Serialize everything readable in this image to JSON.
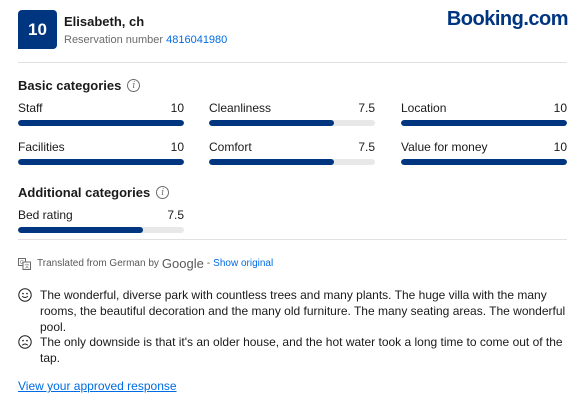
{
  "header": {
    "score": "10",
    "reviewer_name": "Elisabeth, ch",
    "reservation_label": "Reservation number ",
    "reservation_number": "4816041980",
    "logo_booking": "Booking",
    "logo_com": ".com"
  },
  "basic": {
    "title": "Basic categories",
    "items": [
      {
        "label": "Staff",
        "value": "10",
        "fraction": 1.0
      },
      {
        "label": "Cleanliness",
        "value": "7.5",
        "fraction": 0.75
      },
      {
        "label": "Location",
        "value": "10",
        "fraction": 1.0
      },
      {
        "label": "Facilities",
        "value": "10",
        "fraction": 1.0
      },
      {
        "label": "Comfort",
        "value": "7.5",
        "fraction": 0.75
      },
      {
        "label": "Value for money",
        "value": "10",
        "fraction": 1.0
      }
    ]
  },
  "additional": {
    "title": "Additional categories",
    "items": [
      {
        "label": "Bed rating",
        "value": "7.5",
        "fraction": 0.75
      }
    ]
  },
  "translation": {
    "prefix": "Translated from German by",
    "google": "Google",
    "separator": "-",
    "show_original": "Show original"
  },
  "review": {
    "positive": "The wonderful, diverse park with countless trees and many plants. The huge villa with the many rooms, the beautiful decoration and the many old furniture. The many seating areas. The wonderful pool.",
    "negative": "The only downside is that it's an older house, and the hot water took a long time to come out of the tap."
  },
  "footer": {
    "approved_response_link": "View your approved response"
  },
  "colors": {
    "brand_navy": "#003580",
    "link_blue": "#006ce4",
    "track_gray": "#e8e8e8"
  }
}
